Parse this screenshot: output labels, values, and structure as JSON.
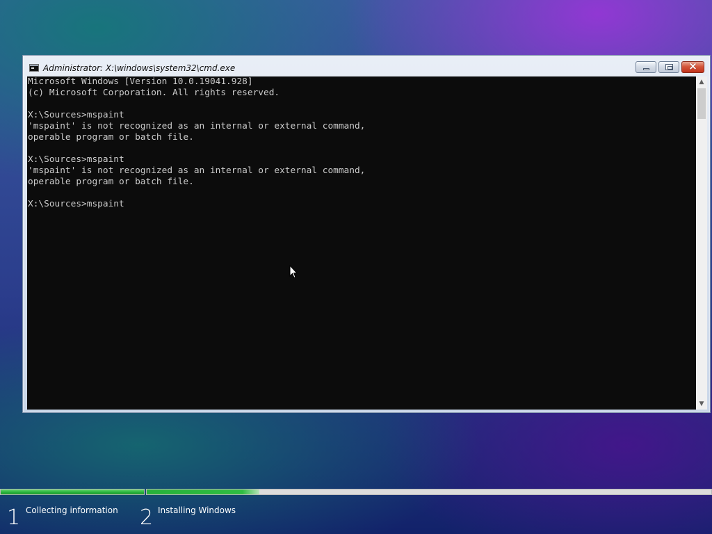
{
  "window": {
    "title": "Administrator: X:\\windows\\system32\\cmd.exe",
    "buttons": {
      "minimize": "minimize",
      "maximize": "restore",
      "close": "×"
    },
    "console_lines": [
      "Microsoft Windows [Version 10.0.19041.928]",
      "(c) Microsoft Corporation. All rights reserved.",
      "",
      "X:\\Sources>mspaint",
      "'mspaint' is not recognized as an internal or external command,",
      "operable program or batch file.",
      "",
      "X:\\Sources>mspaint",
      "'mspaint' is not recognized as an internal or external command,",
      "operable program or batch file.",
      "",
      "X:\\Sources>mspaint"
    ],
    "colors": {
      "console_bg": "#0c0c0c",
      "console_fg": "#cccccc"
    }
  },
  "setup": {
    "steps": [
      {
        "number": "1",
        "label": "Collecting information",
        "progress": 1.0
      },
      {
        "number": "2",
        "label": "Installing Windows",
        "progress": 0.2
      }
    ],
    "accent": "#27b13a"
  },
  "icons": [
    "cmd-icon",
    "minimize-icon",
    "maximize-icon",
    "close-icon",
    "scroll-up-icon",
    "scroll-down-icon",
    "mouse-pointer-icon"
  ]
}
